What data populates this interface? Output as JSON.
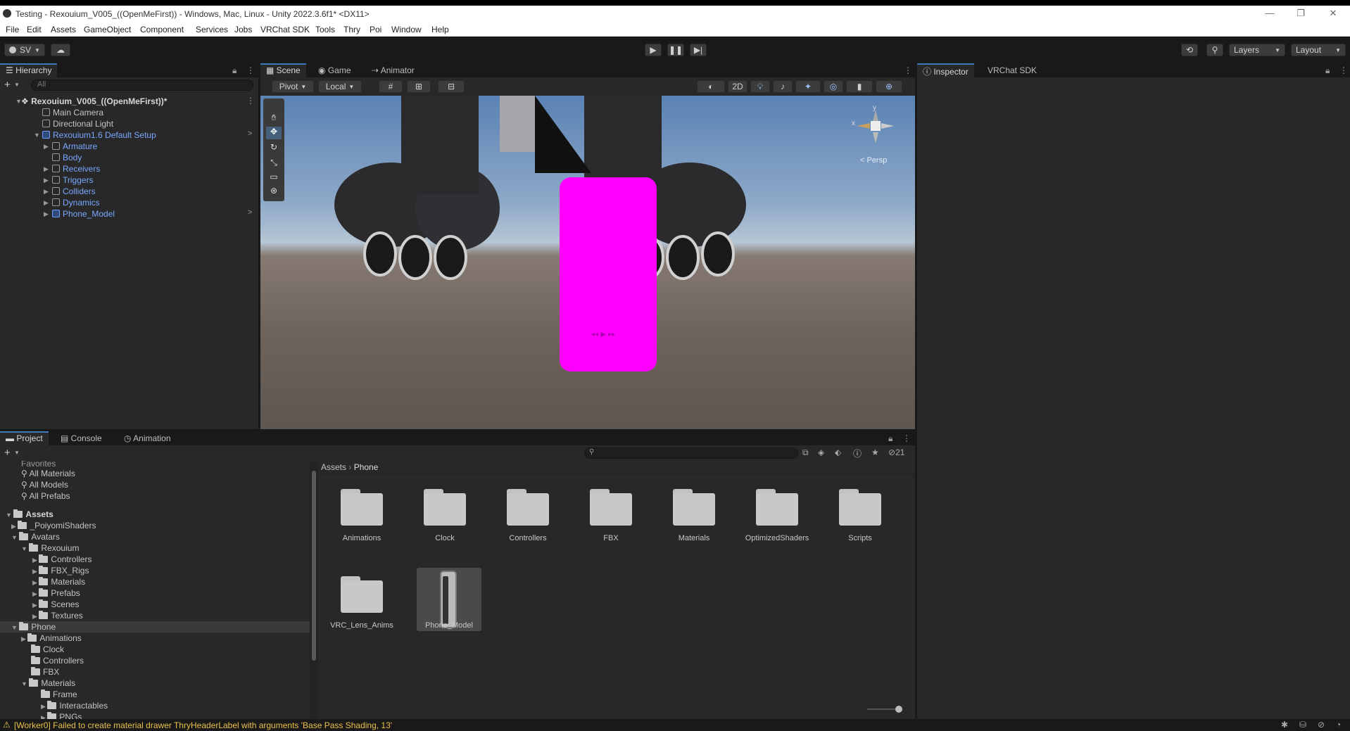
{
  "window": {
    "title": "Testing - Rexouium_V005_((OpenMeFirst)) - Windows, Mac, Linux - Unity 2022.3.6f1* <DX11>"
  },
  "menu": [
    "File",
    "Edit",
    "Assets",
    "GameObject",
    "Component",
    "Services",
    "Jobs",
    "VRChat SDK",
    "Tools",
    "Thry",
    "Poi",
    "Window",
    "Help"
  ],
  "toolbar": {
    "account": "SV",
    "layers": "Layers",
    "layout": "Layout"
  },
  "hierarchy": {
    "tab": "Hierarchy",
    "search_placeholder": "All",
    "scene": "Rexouium_V005_((OpenMeFirst))*",
    "items": [
      {
        "label": "Main Camera"
      },
      {
        "label": "Directional Light"
      },
      {
        "label": "Rexouium1.6 Default Setup"
      },
      {
        "label": "Armature"
      },
      {
        "label": "Body"
      },
      {
        "label": "Receivers"
      },
      {
        "label": "Triggers"
      },
      {
        "label": "Colliders"
      },
      {
        "label": "Dynamics"
      },
      {
        "label": "Phone_Model"
      }
    ]
  },
  "scene_tabs": [
    "Scene",
    "Game",
    "Animator"
  ],
  "scene_toolbar": {
    "pivot": "Pivot",
    "local": "Local",
    "mode2d": "2D"
  },
  "gizmo": {
    "persp": "< Persp",
    "y": "y",
    "x": "x"
  },
  "inspector_tabs": [
    "Inspector",
    "VRChat SDK"
  ],
  "project_tabs": [
    "Project",
    "Console",
    "Animation"
  ],
  "project": {
    "favorites_label": "Favorites",
    "favorites": [
      "All Materials",
      "All Models",
      "All Prefabs"
    ],
    "assets_root": "Assets",
    "tree": [
      {
        "label": "_PoiyomiShaders"
      },
      {
        "label": "Avatars"
      },
      {
        "label": "Rexouium"
      },
      {
        "label": "Controllers"
      },
      {
        "label": "FBX_Rigs"
      },
      {
        "label": "Materials"
      },
      {
        "label": "Prefabs"
      },
      {
        "label": "Scenes"
      },
      {
        "label": "Textures"
      },
      {
        "label": "Phone"
      },
      {
        "label": "Animations"
      },
      {
        "label": "Clock"
      },
      {
        "label": "Controllers"
      },
      {
        "label": "FBX"
      },
      {
        "label": "Materials"
      },
      {
        "label": "Frame"
      },
      {
        "label": "Interactables"
      },
      {
        "label": "PNGs"
      }
    ],
    "breadcrumb": [
      "Assets",
      "Phone"
    ],
    "hidden_count": "21",
    "grid": [
      {
        "label": "Animations"
      },
      {
        "label": "Clock"
      },
      {
        "label": "Controllers"
      },
      {
        "label": "FBX"
      },
      {
        "label": "Materials"
      },
      {
        "label": "OptimizedShaders"
      },
      {
        "label": "Scripts"
      },
      {
        "label": "VRC_Lens_Anims"
      },
      {
        "label": "Phone_Model"
      }
    ]
  },
  "status": {
    "message": "[Worker0] Failed to create material drawer ThryHeaderLabel with arguments 'Base Pass Shading, 13'"
  },
  "colors": {
    "accent": "#3a79bb",
    "phone_magenta": "#ff00ff",
    "prefab_blue": "#7aa7ff",
    "warning": "#e8c04a"
  }
}
